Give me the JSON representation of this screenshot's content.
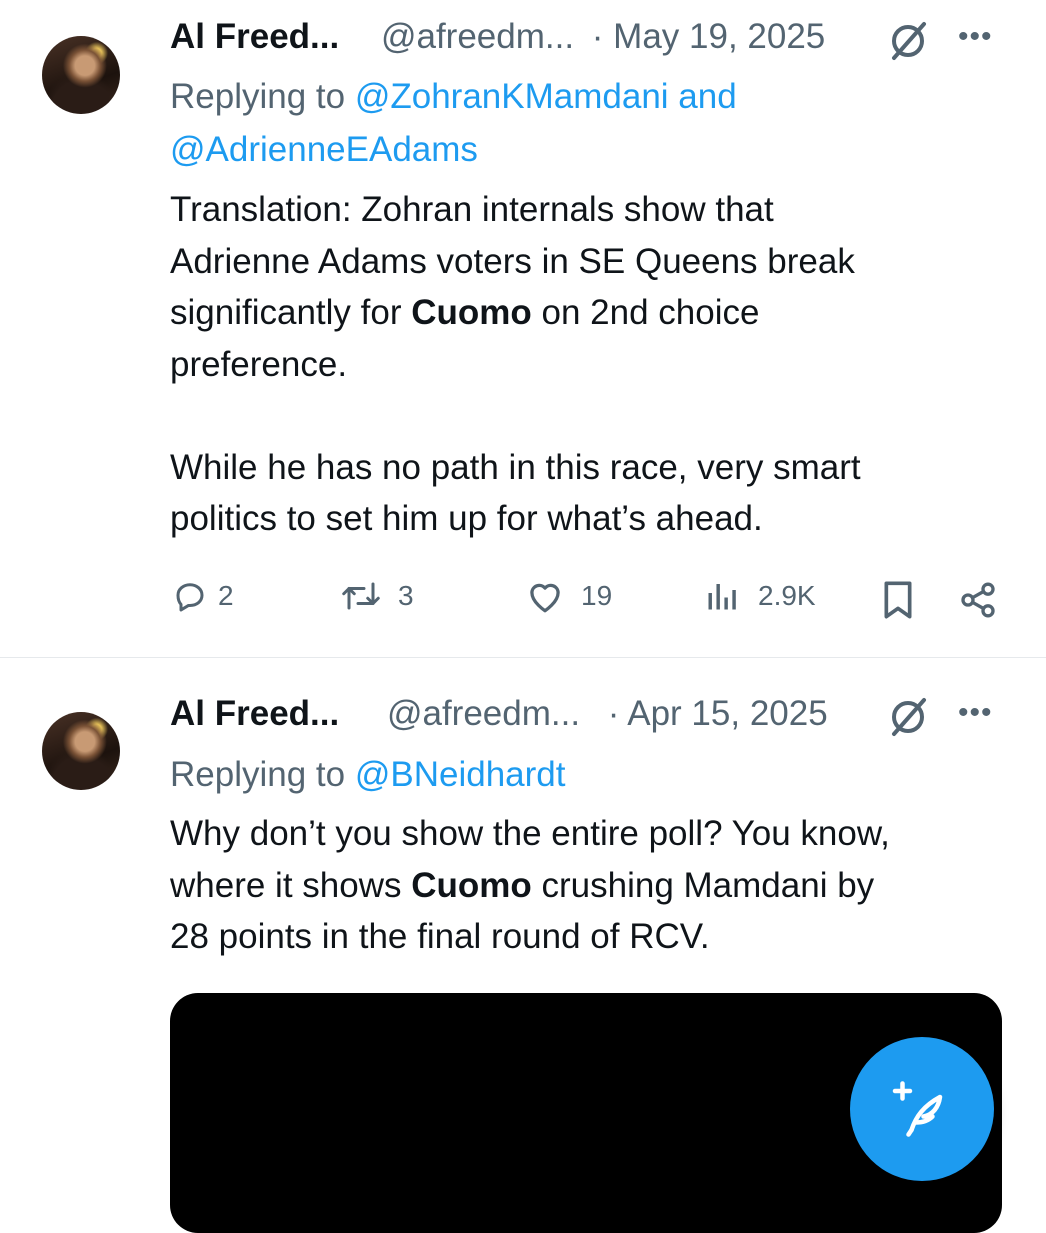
{
  "tweets": [
    {
      "display_name": "Al Freed...",
      "handle": "@afreedm...",
      "date": "· May 19, 2025",
      "replying_prefix": "Replying to",
      "reply_mention_1": "@ZohranKMamdani",
      "reply_and": "and",
      "reply_mention_2": "@AdrienneEAdams",
      "body": {
        "l1": "Translation: Zohran internals show that",
        "l2": "Adrienne Adams voters in SE Queens break",
        "l3a": "significantly for",
        "l3b": "Cuomo",
        "l3c": "on 2nd choice",
        "l4": "preference.",
        "l5": "While he has no path in this race, very smart",
        "l6": "politics to set him up for what’s ahead."
      },
      "counts": {
        "replies": "2",
        "reposts": "3",
        "likes": "19",
        "views": "2.9K"
      }
    },
    {
      "display_name": "Al Freed...",
      "handle": "@afreedm...",
      "date": "· Apr 15, 2025",
      "replying_prefix": "Replying to",
      "reply_mention_1": "@BNeidhardt",
      "body": {
        "l1": "Why don’t you show the entire poll? You know,",
        "l2a": "where it shows",
        "l2b": "Cuomo",
        "l2c": "crushing Mamdani by",
        "l3": "28 points in the final round of RCV."
      }
    }
  ],
  "more_symbol": "•••",
  "colors": {
    "link": "#1d9bf0",
    "muted": "#536471",
    "fab": "#1d9bf0"
  },
  "icons": [
    "verified-slash-icon",
    "more-icon",
    "reply-icon",
    "repost-icon",
    "like-icon",
    "views-icon",
    "bookmark-icon",
    "share-icon",
    "compose-icon"
  ]
}
